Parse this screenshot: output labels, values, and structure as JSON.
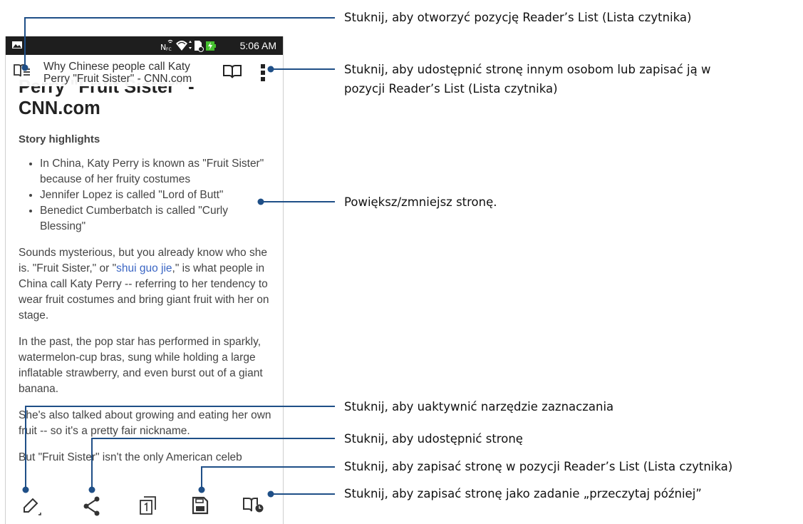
{
  "phone": {
    "status_bar": {
      "left_icon": "image-notification-icon",
      "icons": [
        "nfc-icon",
        "wifi-icon",
        "sim-icon",
        "battery-charging-icon"
      ],
      "time": "5:06 AM"
    },
    "title_bar": {
      "reader_list_icon": "reader-list-icon",
      "page_title": "Why Chinese people call Katy Perry \"Fruit Sister\" - CNN.com",
      "book_icon": "open-book-icon",
      "menu_icon": "more-vert-icon"
    },
    "article": {
      "title": "Perry \"Fruit Sister\" - CNN.com",
      "subheading": "Story highlights",
      "highlights": [
        "In China, Katy Perry is known as \"Fruit Sister\" because of her fruity costumes",
        "Jennifer Lopez is called \"Lord of Butt\"",
        "Benedict Cumberbatch is called \"Curly Blessing\""
      ],
      "p1_before": "Sounds mysterious, but you already know who she is. \"Fruit Sister,\" or \"",
      "p1_link": "shui guo jie",
      "p1_after": ",\" is what people in China call Katy Perry -- referring to her tendency to wear fruit costumes and bring giant fruit with her on stage.",
      "p2": "In the past, the pop star has performed in sparkly, watermelon-cup bras, sung while holding a large inflatable strawberry, and even burst out of a giant banana.",
      "p3": "She's also talked about growing and eating her own fruit -- so it's a pretty fair nickname.",
      "p4": "But \"Fruit Sister\" isn't the only American celeb"
    },
    "bottom_bar": [
      "highlighter-icon",
      "share-icon",
      "page-icon",
      "save-icon",
      "read-later-icon"
    ]
  },
  "callouts": [
    "Stuknij, aby otworzyć pozycję Reader’s List (Lista czytnika)",
    "Stuknij, aby udostępnić stronę innym osobom lub zapisać ją w pozycji Reader’s List (Lista czytnika)",
    "Powiększ/zmniejsz stronę.",
    "Stuknij, aby uaktywnić narzędzie zaznaczania",
    "Stuknij, aby udostępnić stronę",
    "Stuknij, aby zapisać stronę w pozycji Reader’s List (Lista czytnika)",
    "Stuknij, aby zapisać stronę jako zadanie „przeczytaj później”"
  ],
  "colors": {
    "callout_line": "#1f4f87",
    "status_bar": "#1e1e1e",
    "link": "#3b66c4",
    "battery": "#46c02f"
  }
}
